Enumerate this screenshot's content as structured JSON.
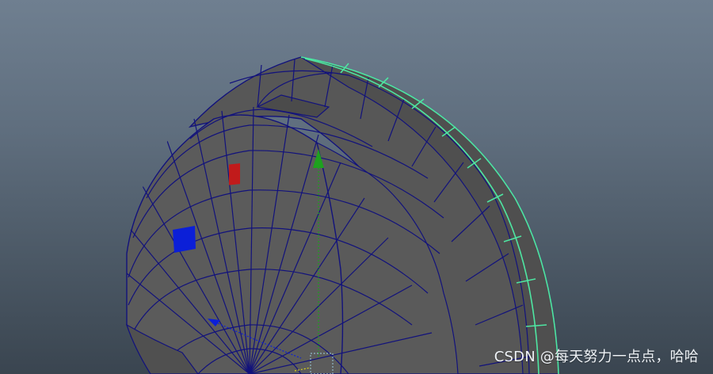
{
  "viewport": {
    "background_top": "#6f7f90",
    "background_bottom": "#3a4550"
  },
  "model": {
    "surface_color": "#565656",
    "wire_color": "#12127c",
    "selected_edge_color": "#4ee6a2",
    "manipulator_y_color": "#1ea11e",
    "manipulator_x_color": "#c11b1b",
    "manipulator_z_color": "#0b1fd8",
    "pivot_color": "#8fb8c8"
  },
  "watermark": {
    "text": "CSDN @每天努力一点点，哈哈"
  }
}
